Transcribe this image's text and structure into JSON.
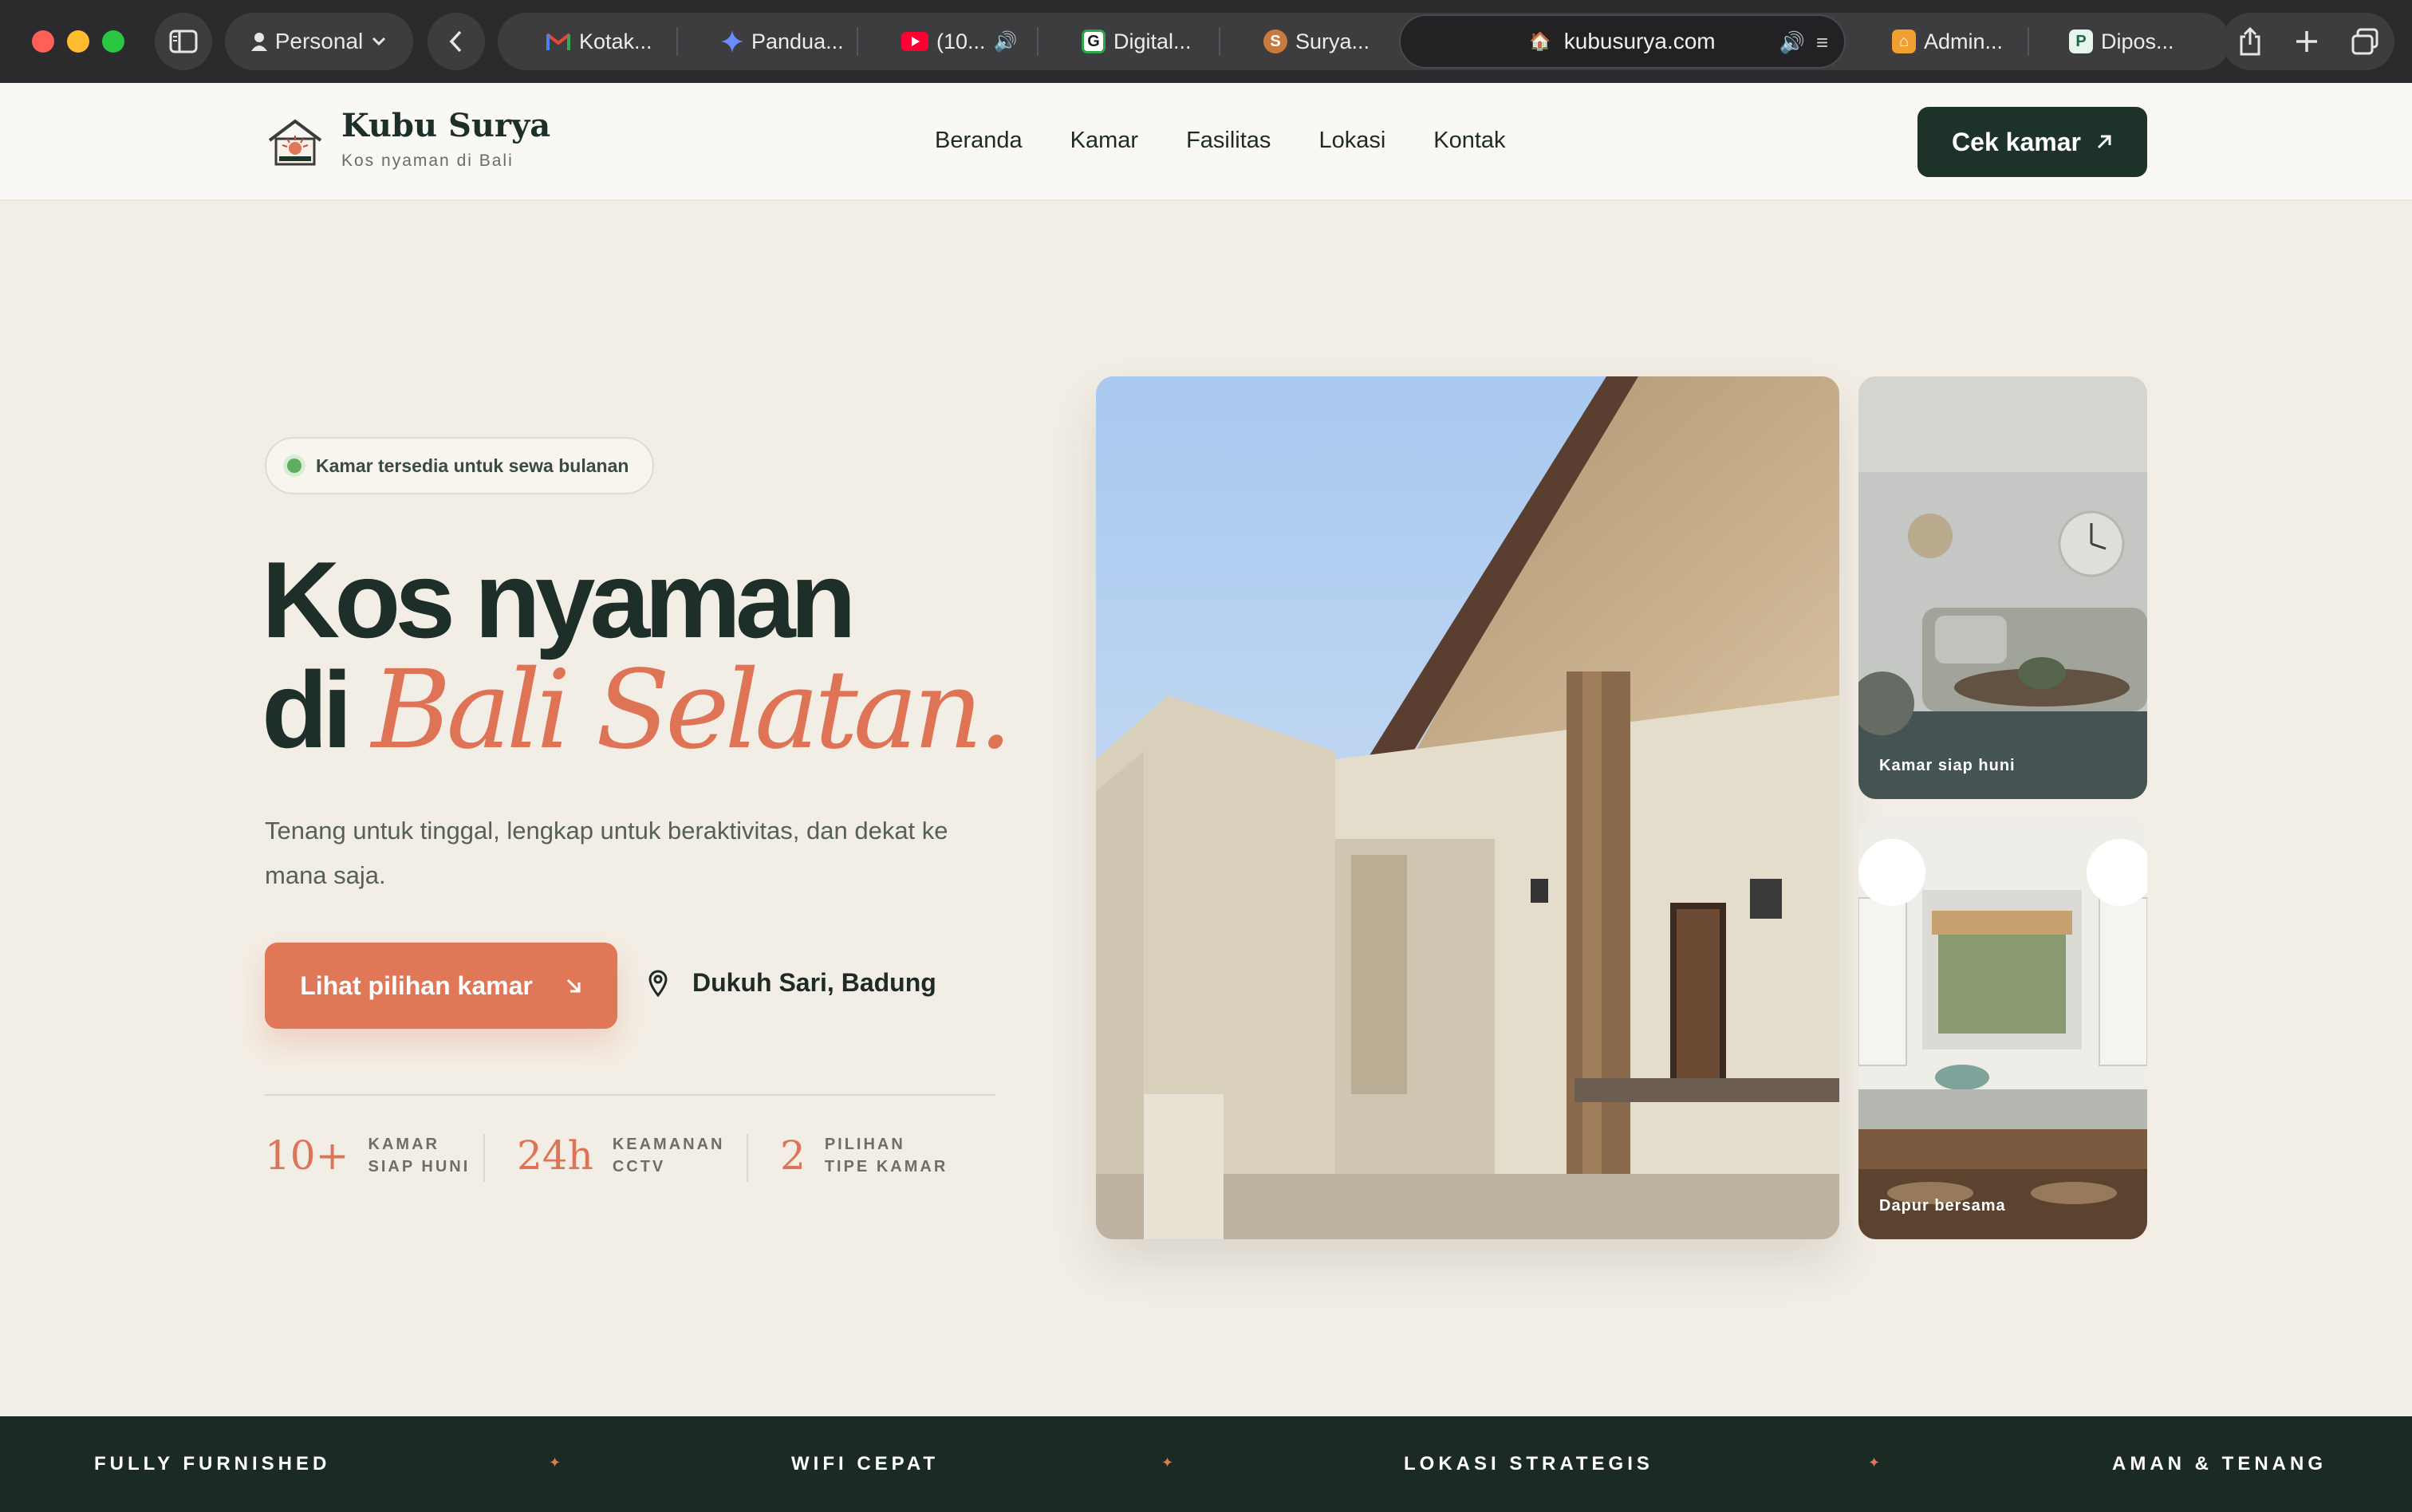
{
  "browser": {
    "profile": "Personal",
    "tabs": [
      {
        "label": "Kotak...",
        "icon": "gmail-icon"
      },
      {
        "label": "Pandua...",
        "icon": "gemini-icon"
      },
      {
        "label": "(10...",
        "icon": "youtube-icon"
      },
      {
        "label": "Digital...",
        "icon": "g-icon"
      },
      {
        "label": "Surya...",
        "icon": "s-icon"
      },
      {
        "label": "Admin...",
        "icon": "admin-icon"
      },
      {
        "label": "Dipos...",
        "icon": "p-icon"
      }
    ],
    "address": "kubusurya.com"
  },
  "header": {
    "brand_name": "Kubu Surya",
    "brand_tagline": "Kos nyaman di Bali",
    "nav": [
      "Beranda",
      "Kamar",
      "Fasilitas",
      "Lokasi",
      "Kontak"
    ],
    "cta": "Cek kamar"
  },
  "hero": {
    "badge": "Kamar tersedia untuk sewa bulanan",
    "title_line1": "Kos nyaman",
    "title_line2_prefix": "di",
    "title_line2_accent": "Bali Selatan.",
    "subtitle": "Tenang untuk tinggal, lengkap untuk beraktivitas, dan dekat ke mana saja.",
    "cta": "Lihat pilihan kamar",
    "location": "Dukuh Sari, Badung",
    "stats": [
      {
        "value": "10+",
        "label1": "KAMAR",
        "label2": "SIAP HUNI"
      },
      {
        "value": "24h",
        "label1": "KEAMANAN",
        "label2": "CCTV"
      },
      {
        "value": "2",
        "label1": "PILIHAN",
        "label2": "TIPE KAMAR"
      }
    ]
  },
  "gallery": {
    "caption_room": "Kamar siap huni",
    "caption_kitchen": "Dapur bersama"
  },
  "ribbon": [
    "FULLY FURNISHED",
    "WIFI CEPAT",
    "LOKASI STRATEGIS",
    "AMAN & TENANG"
  ],
  "colors": {
    "accent": "#de7355",
    "dark_green": "#1d3229",
    "background": "#f3eee5"
  }
}
